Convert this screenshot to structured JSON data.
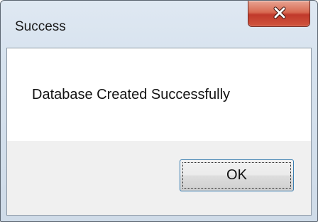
{
  "window": {
    "title": "Success"
  },
  "dialog": {
    "message": "Database Created Successfully",
    "ok_label": "OK"
  },
  "icons": {
    "close": "close-icon"
  },
  "colors": {
    "close_button": "#c0392b",
    "frame": "#d6e2ee",
    "button_border": "#3c7fb1"
  }
}
